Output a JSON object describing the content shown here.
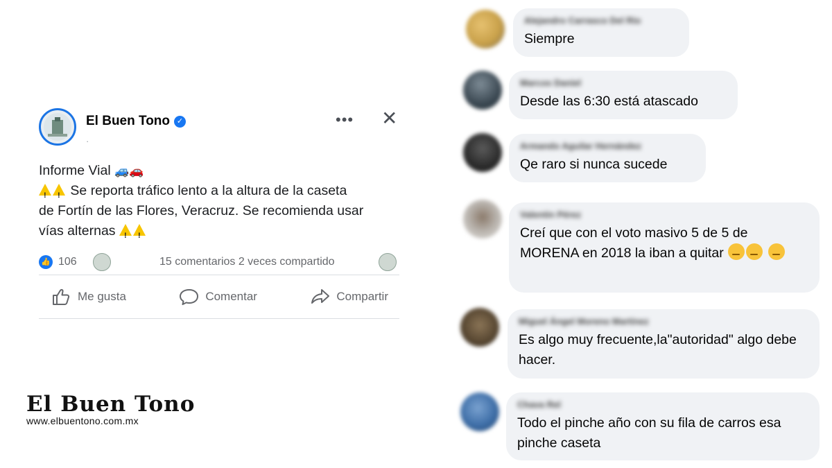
{
  "post": {
    "page_name": "El Buen Tono",
    "meta": "·",
    "more_label": "•••",
    "close_label": "✕",
    "title_line": "Informe Vial",
    "body_line": "Se reporta tráfico lento a la altura de la caseta de Fortín de las Flores, Veracruz. Se recomienda usar vías alternas",
    "reactions_count": "106",
    "comments_shares": "15 comentarios 2 veces compartido",
    "actions": {
      "like": "Me gusta",
      "comment": "Comentar",
      "share": "Compartir"
    },
    "icons": [
      "verified-badge-icon",
      "warning-icon",
      "car-icon",
      "like-icon",
      "comment-icon",
      "share-icon"
    ]
  },
  "brand": {
    "name": "El Buen Tono",
    "url": "www.elbuentono.com.mx"
  },
  "comments": [
    {
      "name": "Alejandro Carrasco Del Río",
      "text": "Siempre",
      "avatar_color": "#c9a14a"
    },
    {
      "name": "Marcos Daniel",
      "text": "Desde las 6:30 está atascado",
      "avatar_color": "#3b4852"
    },
    {
      "name": "Armando Aguilar Hernández",
      "text": "Qe raro si nunca sucede",
      "avatar_color": "#2b2b2b"
    },
    {
      "name": "Valentin Pérez",
      "text": "Creí que con el voto masivo 5 de 5 de MORENA en 2018 la iban a quitar",
      "avatar_color": "#b9b4ae"
    },
    {
      "name": "Miguel Ángel Moreno Martínez",
      "text": "Es algo muy frecuente,la\"autoridad\" algo debe hacer.",
      "avatar_color": "#5b4a34"
    },
    {
      "name": "Chava Rel",
      "text": "Todo el pinche año con su fila de carros esa pinche caseta",
      "avatar_color": "#3f6fa8"
    }
  ],
  "colors": {
    "accent": "#1877f2",
    "bubble": "#f0f2f5",
    "muted_text": "#65676b"
  }
}
